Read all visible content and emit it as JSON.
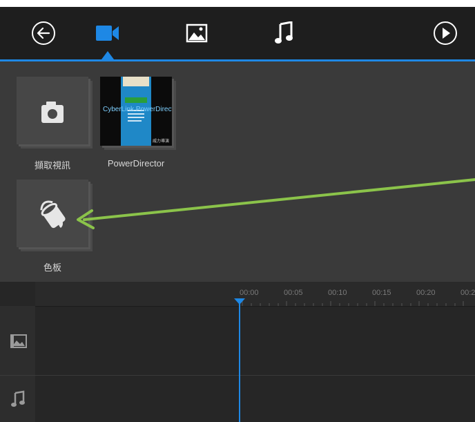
{
  "toolbar": {
    "back_icon": "back-arrow-icon",
    "tabs": [
      {
        "icon": "video-camera-icon",
        "active": true
      },
      {
        "icon": "image-icon",
        "active": false
      },
      {
        "icon": "music-note-icon",
        "active": false
      }
    ],
    "play_icon": "play-icon",
    "accent_color": "#1e88e5"
  },
  "library": {
    "items": [
      {
        "label": "擷取視訊",
        "icon": "camera-icon"
      },
      {
        "label": "PowerDirector",
        "thumbnail_text": "CyberLink PowerDirector",
        "thumbnail_corner_text": "威力導演"
      },
      {
        "label": "色板",
        "icon": "paint-bucket-icon"
      }
    ]
  },
  "timeline": {
    "ruler_ticks": [
      "00:00",
      "00:05",
      "00:10",
      "00:15",
      "00:20",
      "00:2"
    ],
    "tracks": [
      {
        "icon": "video-track-icon"
      },
      {
        "icon": "music-track-icon"
      }
    ]
  },
  "annotation": {
    "arrow_color": "#8bc34a"
  }
}
